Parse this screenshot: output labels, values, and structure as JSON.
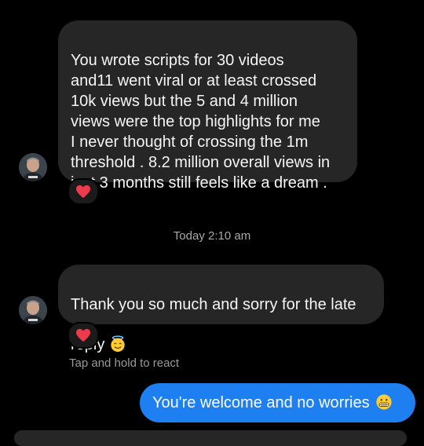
{
  "thread": {
    "messages": [
      {
        "direction": "incoming",
        "text": "You wrote scripts for 30 videos\nand11 went viral or at least crossed\n10k views but the 5 and 4 million\nviews were the top highlights for me\nI never thought of crossing the 1m\nthreshold . 8.2 million overall views in\njust 3 months still feels like a dream .",
        "reaction": "red-heart"
      },
      {
        "direction": "incoming",
        "text": "Thank you so much and sorry for the late\nreply",
        "emoji": "smiling-face-with-halo",
        "reaction": "red-heart"
      },
      {
        "direction": "outgoing",
        "text": "You're welcome and no worries",
        "emoji": "grimacing-face"
      }
    ],
    "timestamp": "Today 2:10 am",
    "react_hint": "Tap and hold to react"
  },
  "colors": {
    "background": "#000000",
    "incoming_bubble": "#262626",
    "outgoing_bubble": "#1d7ff0",
    "timestamp_text": "#a8a8a8",
    "heart": "#ed3b4b"
  },
  "icons": {
    "avatar": "contact-avatar",
    "reaction": "red-heart-icon",
    "emoji_1": "smiling-face-with-halo-icon",
    "emoji_2": "grimacing-face-icon"
  }
}
